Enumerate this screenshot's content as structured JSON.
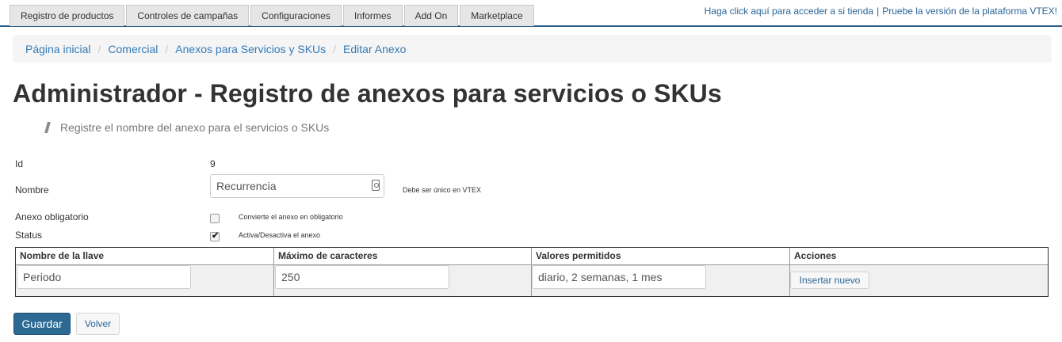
{
  "topnav": {
    "tabs": [
      {
        "label": "Registro de productos"
      },
      {
        "label": "Controles de campañas"
      },
      {
        "label": "Configuraciones"
      },
      {
        "label": "Informes"
      },
      {
        "label": "Add On"
      },
      {
        "label": "Marketplace"
      }
    ],
    "store_link": "Haga click aquí para acceder a si tienda",
    "separator": "|",
    "vtex_link": "Pruebe la versión de la plataforma VTEX!"
  },
  "breadcrumb": {
    "items": [
      {
        "label": "Página inicial"
      },
      {
        "label": "Comercial"
      },
      {
        "label": "Anexos para Servicios y SKUs"
      },
      {
        "label": "Editar Anexo"
      }
    ],
    "separator": "/"
  },
  "page": {
    "title": "Administrador - Registro de anexos para servicios o SKUs",
    "subtitle": "Registre el nombre del anexo para el servicios o SKUs"
  },
  "form": {
    "id_label": "Id",
    "id_value": "9",
    "name_label": "Nombre",
    "name_value": "Recurrencia",
    "name_hint": "Debe ser único en VTEX",
    "mandatory_label": "Anexo obligatorio",
    "mandatory_checked": false,
    "mandatory_hint": "Convierte el anexo en obligatorio",
    "status_label": "Status",
    "status_checked": true,
    "status_hint": "Activa/Desactiva el anexo",
    "check_mark": "✔"
  },
  "keys_table": {
    "headers": [
      "Nombre de la llave",
      "Máximo de caracteres",
      "Valores permitidos",
      "Acciones"
    ],
    "row": {
      "key_name": "Periodo",
      "max_chars": "250",
      "allowed_values": "diario, 2 semanas, 1 mes"
    },
    "insert_label": "Insertar nuevo"
  },
  "actions": {
    "save_label": "Guardar",
    "back_label": "Volver"
  },
  "colors": {
    "accent": "#2c6a94",
    "link": "#337ab7",
    "topbar_rule": "#2b5d86"
  }
}
